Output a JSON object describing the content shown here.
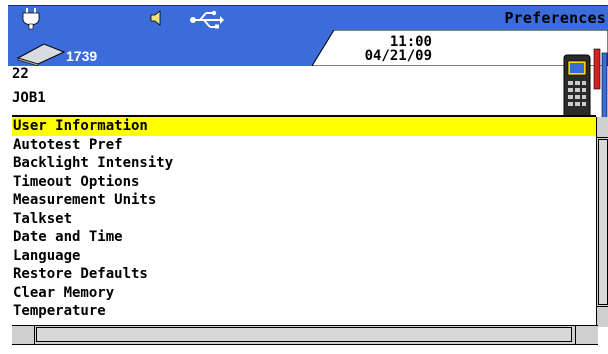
{
  "header": {
    "title": "Preferences",
    "counter": "1739",
    "time": "11:00",
    "date": "04/21/09",
    "icons": [
      "power-plug-icon",
      "speaker-icon",
      "usb-icon",
      "memory-card-icon",
      "test-device-icon"
    ]
  },
  "info": {
    "line1": "22",
    "line2": "JOB1"
  },
  "menu": {
    "selected_index": 0,
    "items": [
      {
        "label": "User Information"
      },
      {
        "label": "Autotest Pref"
      },
      {
        "label": "Backlight Intensity"
      },
      {
        "label": "Timeout Options"
      },
      {
        "label": "Measurement Units"
      },
      {
        "label": "Talkset"
      },
      {
        "label": "Date and Time"
      },
      {
        "label": "Language"
      },
      {
        "label": "Restore Defaults"
      },
      {
        "label": "Clear Memory"
      },
      {
        "label": "Temperature"
      }
    ]
  },
  "colors": {
    "header_bg": "#3b6cd9",
    "selection": "#ffff00",
    "scrollbar": "#cfcfcf"
  }
}
